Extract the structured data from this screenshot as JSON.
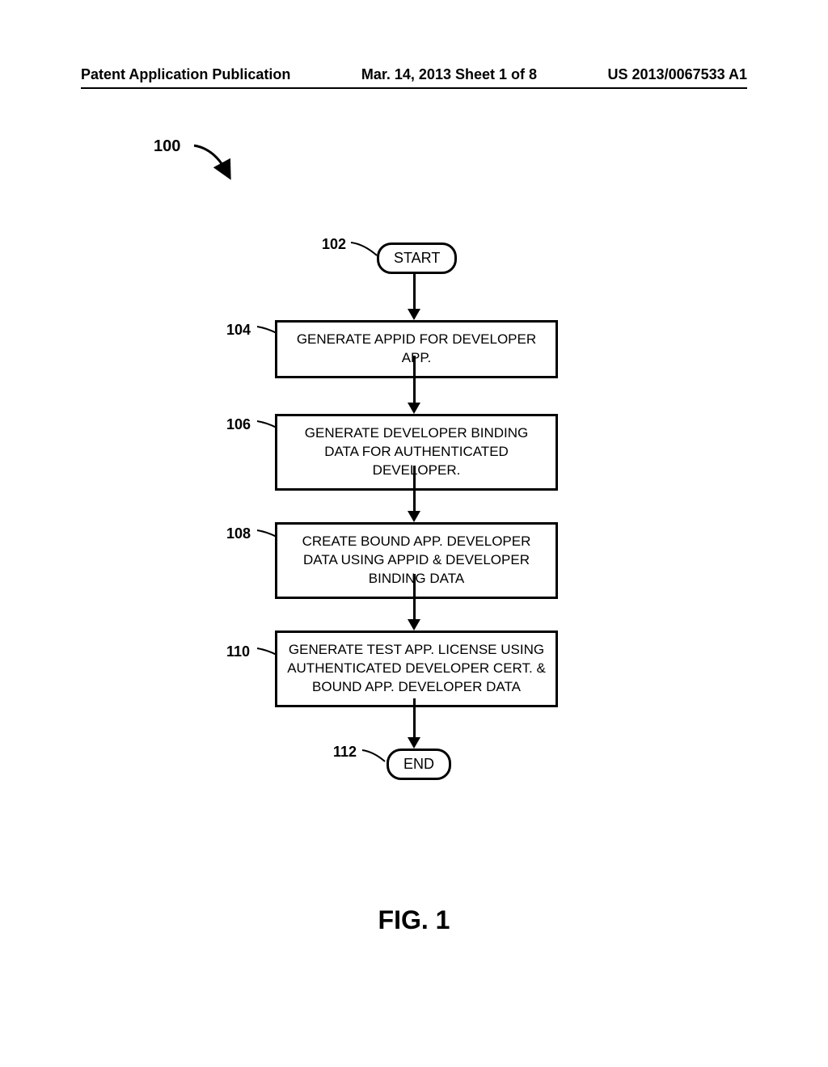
{
  "header": {
    "left": "Patent Application Publication",
    "center": "Mar. 14, 2013  Sheet 1 of 8",
    "right": "US 2013/0067533 A1"
  },
  "diagram": {
    "overall_ref": "100",
    "start_ref": "102",
    "start_label": "START",
    "steps": [
      {
        "ref": "104",
        "text": "GENERATE APPID FOR DEVELOPER APP."
      },
      {
        "ref": "106",
        "text": "GENERATE DEVELOPER BINDING DATA FOR AUTHENTICATED DEVELOPER."
      },
      {
        "ref": "108",
        "text": "CREATE BOUND APP. DEVELOPER DATA USING APPID & DEVELOPER BINDING DATA"
      },
      {
        "ref": "110",
        "text": "GENERATE TEST APP. LICENSE USING AUTHENTICATED DEVELOPER CERT. & BOUND APP. DEVELOPER DATA"
      }
    ],
    "end_ref": "112",
    "end_label": "END"
  },
  "figure_caption": "FIG. 1"
}
